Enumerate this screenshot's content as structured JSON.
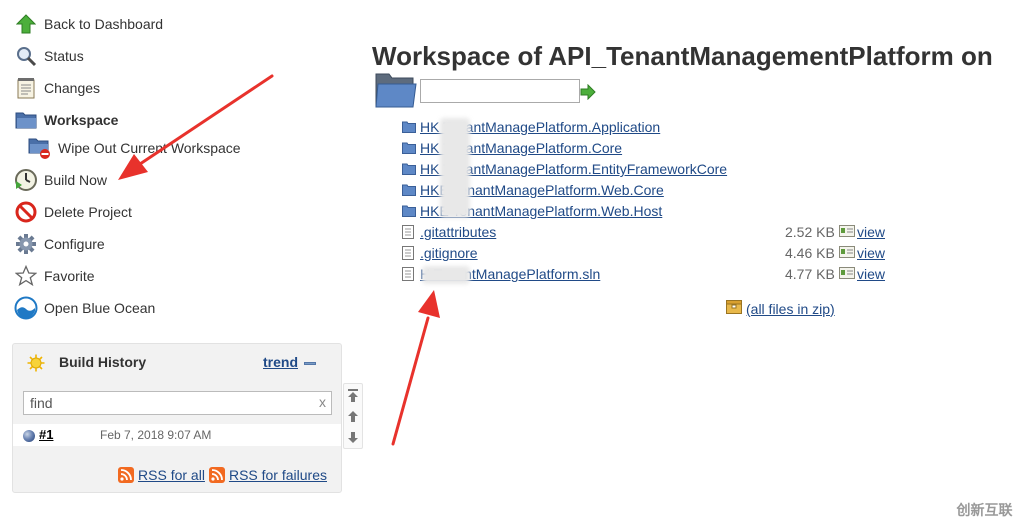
{
  "tasks": [
    {
      "label": "Back to Dashboard",
      "icon": "up-arrow-icon"
    },
    {
      "label": "Status",
      "icon": "magnifier-icon"
    },
    {
      "label": "Changes",
      "icon": "notepad-icon"
    },
    {
      "label": "Workspace",
      "icon": "folder-icon"
    },
    {
      "label": "Wipe Out Current Workspace",
      "icon": "folder-delete-icon"
    },
    {
      "label": "Build Now",
      "icon": "clock-play-icon"
    },
    {
      "label": "Delete Project",
      "icon": "no-entry-icon"
    },
    {
      "label": "Configure",
      "icon": "gear-icon"
    },
    {
      "label": "Favorite",
      "icon": "star-icon"
    },
    {
      "label": "Open Blue Ocean",
      "icon": "blue-ocean-icon"
    }
  ],
  "build_history": {
    "title": "Build History",
    "trend_label": "trend",
    "search_value": "find",
    "clear_label": "x",
    "builds": [
      {
        "number": "#1",
        "date": "Feb 7, 2018 9:07 AM"
      }
    ],
    "rss_all": "RSS for all",
    "rss_failures": "RSS for failures"
  },
  "workspace": {
    "title": "Workspace of API_TenantManagementPlatform on",
    "path_value": "",
    "entries": [
      {
        "name": "HK TenantManagePlatform.Application",
        "type": "folder",
        "size": "",
        "view": ""
      },
      {
        "name": "HK TenantManagePlatform.Core",
        "type": "folder",
        "size": "",
        "view": ""
      },
      {
        "name": "HK TenantManagePlatform.EntityFrameworkCore",
        "type": "folder",
        "size": "",
        "view": ""
      },
      {
        "name": "HKE TenantManagePlatform.Web.Core",
        "type": "folder",
        "size": "",
        "view": ""
      },
      {
        "name": "HKE TenantManagePlatform.Web.Host",
        "type": "folder",
        "size": "",
        "view": ""
      },
      {
        "name": ".gitattributes",
        "type": "file",
        "size": "2.52 KB",
        "view": "view"
      },
      {
        "name": ".gitignore",
        "type": "file",
        "size": "4.46 KB",
        "view": "view"
      },
      {
        "name": "H    TenantManagePlatform.sln",
        "type": "file",
        "size": "4.77 KB",
        "view": "view"
      }
    ],
    "zip_label": "(all files in zip)"
  },
  "watermark": "创新互联",
  "colors": {
    "link": "#204a87",
    "annotation_red": "#e8322c",
    "panel_bg": "#f2f2f2"
  }
}
